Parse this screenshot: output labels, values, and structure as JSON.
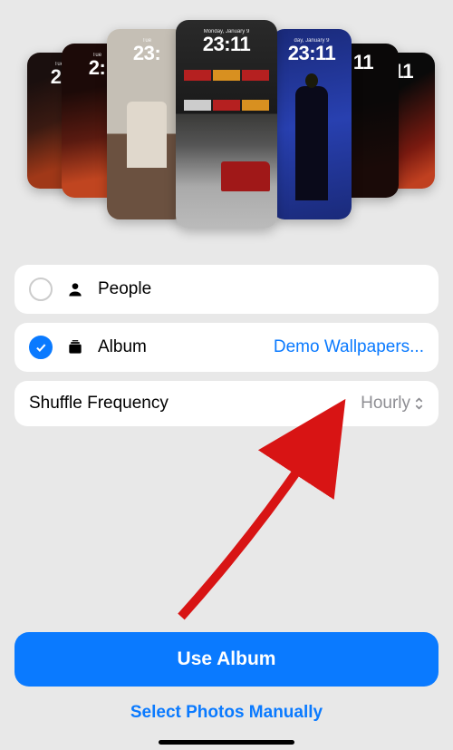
{
  "wallpapers": [
    {
      "date": "Tue",
      "time": "2:"
    },
    {
      "date": "Tue",
      "time": "2:"
    },
    {
      "date": "Tue",
      "time": "23:"
    },
    {
      "date": "Monday, January 9",
      "time": "23:11"
    },
    {
      "date": "day, January 9",
      "time": "23:11"
    },
    {
      "date": "",
      "time": "11"
    },
    {
      "date": "",
      "time": "11"
    }
  ],
  "options": {
    "people": {
      "label": "People",
      "selected": false
    },
    "album": {
      "label": "Album",
      "selected": true,
      "value": "Demo Wallpapers..."
    }
  },
  "shuffle": {
    "label": "Shuffle Frequency",
    "value": "Hourly"
  },
  "buttons": {
    "primary": "Use Album",
    "secondary": "Select Photos Manually"
  },
  "colors": {
    "accent": "#0a7aff"
  }
}
